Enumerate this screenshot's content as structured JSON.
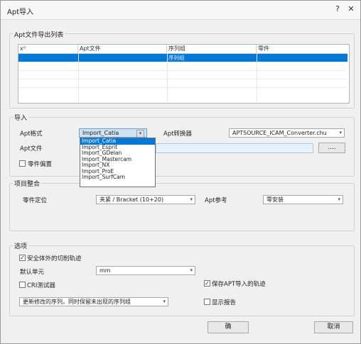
{
  "window": {
    "title": "Apt导入",
    "help_label": "?",
    "close_label": "✕"
  },
  "export_group": {
    "label": "Apt文件导出列表",
    "columns": [
      "x⁰",
      "Apt文件",
      "序列组",
      "零件"
    ],
    "selected_cell": "序列组"
  },
  "import_group": {
    "label": "导入",
    "apt_format_label": "Apt格式",
    "apt_format_value": "Import_Catia",
    "apt_format_options": [
      "Import_Catia",
      "Import_Esprit",
      "Import_GDelan",
      "Import_Mastercam",
      "Import_NX",
      "Import_ProE",
      "Import_SurfCam"
    ],
    "converter_label": "Apt转换器",
    "converter_value": "APTSOURCE_ICAM_Converter.chu",
    "apt_file_label": "Apt文件",
    "browse_label": "....",
    "part_offset_label": "零件偏置"
  },
  "project_group": {
    "label": "项目整合",
    "part_pos_label": "零件定位",
    "part_pos_value": "夹紧 / Bracket (10+20)",
    "apt_ref_label": "Apt参考",
    "apt_ref_value": "零安装"
  },
  "options_group": {
    "label": "选项",
    "safe_cut_label": "安全体外的切削轨迹",
    "safe_cut_checked": true,
    "default_unit_label": "默认单元",
    "default_unit_value": "mm",
    "cri_label": "CRI测试器",
    "save_apt_label": "保存APT导入的轨迹",
    "save_apt_checked": true,
    "sequence_value": "更新修改的序列，同时保留未出现的序列组",
    "show_report_label": "显示报告"
  },
  "footer": {
    "ok_label": "确",
    "cancel_label": "取消"
  },
  "colors": {
    "selection": "#0078d7"
  }
}
